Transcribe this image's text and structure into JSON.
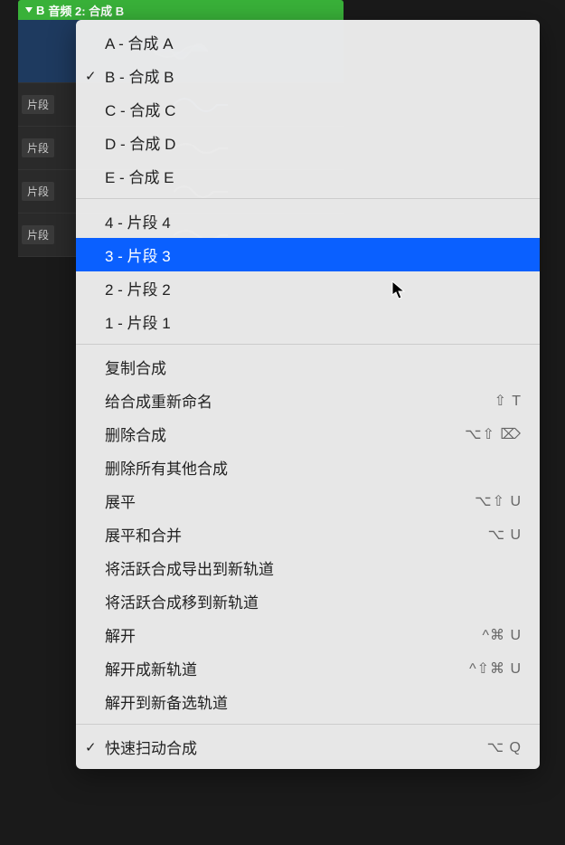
{
  "header": {
    "letter": "B",
    "title": "音频 2: 合成 B"
  },
  "tracks": {
    "label": "片段"
  },
  "menu": {
    "compsGroup": [
      {
        "key": "A",
        "label": "A - 合成 A",
        "checked": false
      },
      {
        "key": "B",
        "label": "B - 合成 B",
        "checked": true
      },
      {
        "key": "C",
        "label": "C - 合成 C",
        "checked": false
      },
      {
        "key": "D",
        "label": "D - 合成 D",
        "checked": false
      },
      {
        "key": "E",
        "label": "E - 合成 E",
        "checked": false
      }
    ],
    "takesGroup": [
      {
        "key": "4",
        "label": "4 - 片段 4",
        "highlighted": false
      },
      {
        "key": "3",
        "label": "3 - 片段 3",
        "highlighted": true
      },
      {
        "key": "2",
        "label": "2 - 片段 2",
        "highlighted": false
      },
      {
        "key": "1",
        "label": "1 - 片段 1",
        "highlighted": false
      }
    ],
    "actionsGroup": [
      {
        "label": "复制合成",
        "shortcut": ""
      },
      {
        "label": "给合成重新命名",
        "shortcut": "⇧ T"
      },
      {
        "label": "删除合成",
        "shortcut": "⌥⇧ ⌦"
      },
      {
        "label": "删除所有其他合成",
        "shortcut": ""
      },
      {
        "label": "展平",
        "shortcut": "⌥⇧ U"
      },
      {
        "label": "展平和合并",
        "shortcut": "⌥ U"
      },
      {
        "label": "将活跃合成导出到新轨道",
        "shortcut": ""
      },
      {
        "label": "将活跃合成移到新轨道",
        "shortcut": ""
      },
      {
        "label": "解开",
        "shortcut": "^⌘ U"
      },
      {
        "label": "解开成新轨道",
        "shortcut": "^⇧⌘ U"
      },
      {
        "label": "解开到新备选轨道",
        "shortcut": ""
      }
    ],
    "footerGroup": [
      {
        "label": "快速扫动合成",
        "shortcut": "⌥ Q",
        "checked": true
      }
    ]
  }
}
